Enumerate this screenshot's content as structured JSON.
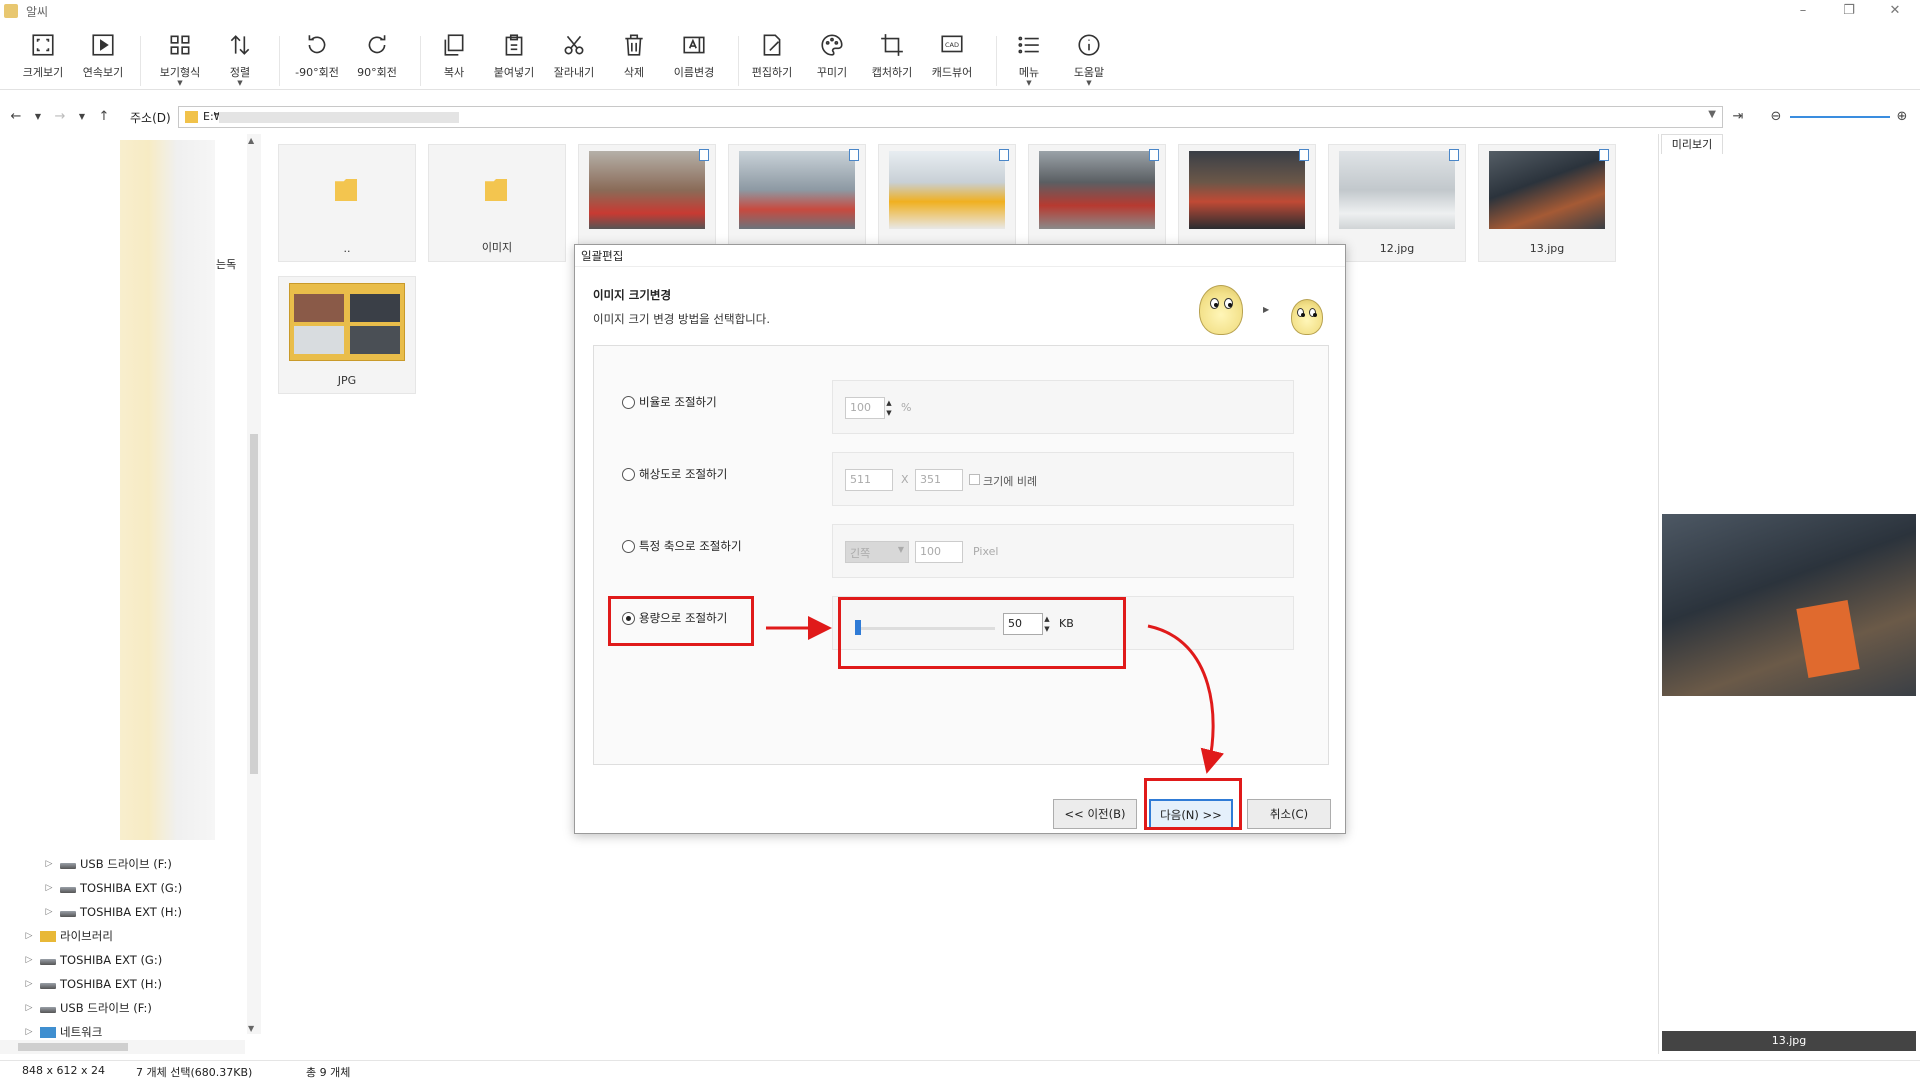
{
  "window": {
    "title": "알씨"
  },
  "toolbar": {
    "items": [
      {
        "label": "크게보기",
        "icon": "fullscreen-icon"
      },
      {
        "label": "연속보기",
        "icon": "play-icon"
      },
      {
        "label": "보기형식",
        "icon": "grid-view-icon"
      },
      {
        "label": "정렬",
        "icon": "sort-icon"
      },
      {
        "label": "-90°회전",
        "icon": "rotate-left-icon"
      },
      {
        "label": "90°회전",
        "icon": "rotate-right-icon"
      },
      {
        "label": "복사",
        "icon": "copy-icon"
      },
      {
        "label": "붙여넣기",
        "icon": "paste-icon"
      },
      {
        "label": "잘라내기",
        "icon": "cut-icon"
      },
      {
        "label": "삭제",
        "icon": "trash-icon"
      },
      {
        "label": "이름변경",
        "icon": "rename-icon"
      },
      {
        "label": "편집하기",
        "icon": "edit-icon"
      },
      {
        "label": "꾸미기",
        "icon": "palette-icon"
      },
      {
        "label": "캡처하기",
        "icon": "crop-icon"
      },
      {
        "label": "캐드뷰어",
        "icon": "cad-icon"
      },
      {
        "label": "메뉴",
        "icon": "menu-list-icon"
      },
      {
        "label": "도움말",
        "icon": "info-icon"
      }
    ]
  },
  "address": {
    "label": "주소(D)",
    "path": "E:₩"
  },
  "tree": {
    "partial_label": "는독",
    "nodes": [
      {
        "label": "USB 드라이브 (F:)",
        "type": "drive"
      },
      {
        "label": "TOSHIBA EXT (G:)",
        "type": "drive"
      },
      {
        "label": "TOSHIBA EXT (H:)",
        "type": "drive"
      },
      {
        "label": "라이브러리",
        "type": "library"
      },
      {
        "label": "TOSHIBA EXT (G:)",
        "type": "drive"
      },
      {
        "label": "TOSHIBA EXT (H:)",
        "type": "drive"
      },
      {
        "label": "USB 드라이브 (F:)",
        "type": "drive"
      },
      {
        "label": "네트워크",
        "type": "network"
      }
    ]
  },
  "files": {
    "tiles": [
      {
        "caption": ".."
      },
      {
        "caption": "이미지"
      },
      {
        "caption": ""
      },
      {
        "caption": ""
      },
      {
        "caption": ""
      },
      {
        "caption": ""
      },
      {
        "caption": ""
      },
      {
        "caption": "12.jpg"
      },
      {
        "caption": "13.jpg"
      },
      {
        "caption": "JPG"
      }
    ]
  },
  "preview": {
    "tab": "미리보기",
    "filename": "13.jpg"
  },
  "status": {
    "dimensions": "848 x 612 x 24",
    "selection": "7 개체 선택(680.37KB)",
    "total": "총 9 개체"
  },
  "dialog": {
    "title": "일괄편집",
    "section_title": "이미지 크기변경",
    "section_desc": "이미지 크기 변경 방법을 선택합니다.",
    "options": {
      "ratio": {
        "label": "비율로 조절하기",
        "value": "100",
        "unit": "%"
      },
      "resolution": {
        "label": "해상도로 조절하기",
        "width": "511",
        "sep": "X",
        "height": "351",
        "keep_label": "크기에 비례"
      },
      "axis": {
        "label": "특정 축으로 조절하기",
        "axis_value": "긴쪽",
        "value": "100",
        "unit": "Pixel"
      },
      "size": {
        "label": "용량으로 조절하기",
        "value": "50",
        "unit": "KB"
      }
    },
    "buttons": {
      "prev": "<< 이전(B)",
      "next": "다음(N) >>",
      "cancel": "취소(C)"
    }
  },
  "colors": {
    "highlight": "#e01a1a",
    "accent": "#2f7bd6"
  }
}
